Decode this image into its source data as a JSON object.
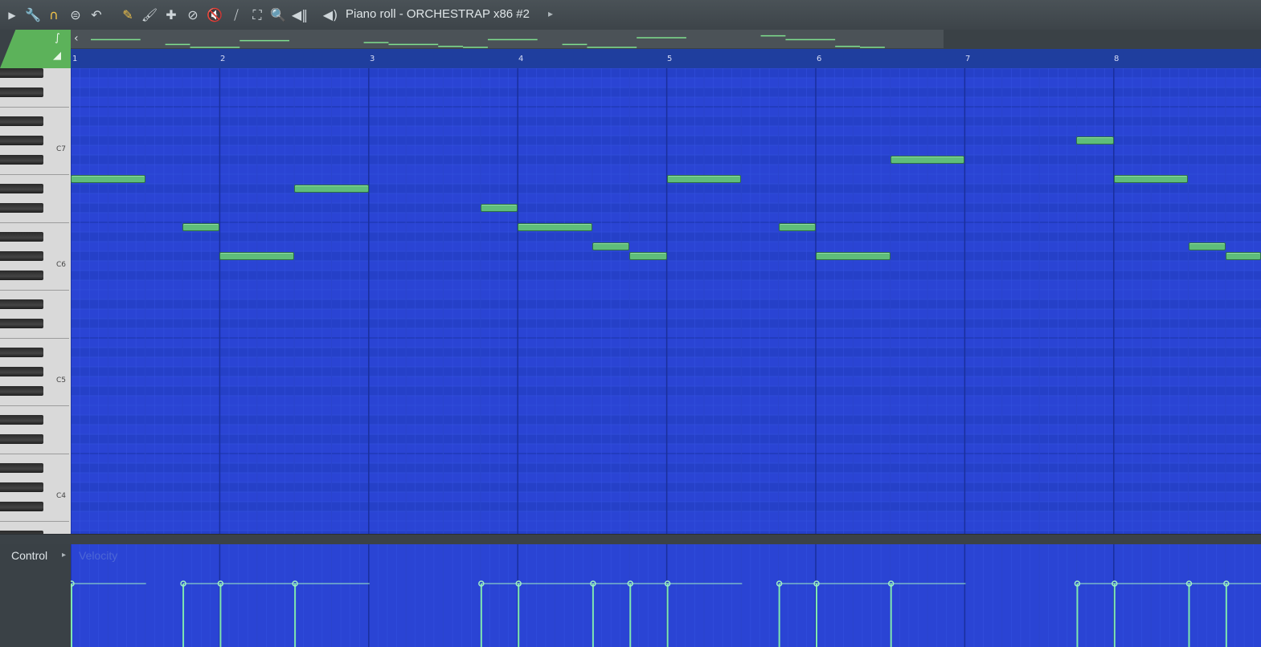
{
  "window": {
    "title": "Piano roll - ORCHESTRAP x86 #2"
  },
  "toolbar": {
    "icons": [
      "play-menu-icon",
      "wrench-icon",
      "magnet-icon",
      "stamp-icon",
      "undo-icon",
      "pencil-icon",
      "paint-icon",
      "delete-icon",
      "mute-icon",
      "mute-icon-2",
      "slice-icon",
      "select-icon",
      "zoom-icon",
      "playback-icon",
      "speaker-icon"
    ]
  },
  "ruler": {
    "bars": [
      "1",
      "2",
      "3",
      "4",
      "5",
      "6",
      "7",
      "8"
    ]
  },
  "keyboard": {
    "octave_labels": [
      "C7",
      "C6",
      "C5",
      "C4"
    ]
  },
  "control": {
    "label": "Control",
    "target": "Velocity"
  },
  "notes": [
    {
      "bar": 1.0,
      "length": 0.5,
      "pitch": 88
    },
    {
      "bar": 1.75,
      "length": 0.25,
      "pitch": 83
    },
    {
      "bar": 2.0,
      "length": 0.5,
      "pitch": 80
    },
    {
      "bar": 2.5,
      "length": 0.5,
      "pitch": 87
    },
    {
      "bar": 3.75,
      "length": 0.25,
      "pitch": 85
    },
    {
      "bar": 4.0,
      "length": 0.5,
      "pitch": 83
    },
    {
      "bar": 4.5,
      "length": 0.25,
      "pitch": 81
    },
    {
      "bar": 4.75,
      "length": 0.25,
      "pitch": 80
    },
    {
      "bar": 5.0,
      "length": 0.5,
      "pitch": 88
    },
    {
      "bar": 5.75,
      "length": 0.25,
      "pitch": 83
    },
    {
      "bar": 6.0,
      "length": 0.5,
      "pitch": 80
    },
    {
      "bar": 6.5,
      "length": 0.5,
      "pitch": 90
    },
    {
      "bar": 7.75,
      "length": 0.25,
      "pitch": 92
    },
    {
      "bar": 8.0,
      "length": 0.5,
      "pitch": 88
    },
    {
      "bar": 8.5,
      "length": 0.25,
      "pitch": 81
    },
    {
      "bar": 8.75,
      "length": 0.25,
      "pitch": 80
    }
  ],
  "colors": {
    "grid": "#2a44d4",
    "note": "#5fbd7a",
    "accent": "#5cb25a"
  }
}
